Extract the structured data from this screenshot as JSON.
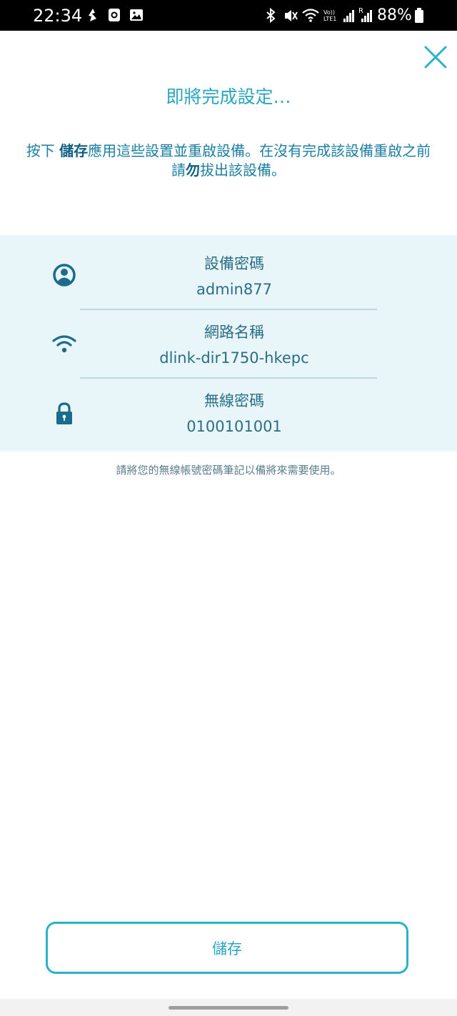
{
  "status_bar": {
    "time": "22:34",
    "battery": "88%",
    "icons": [
      "notification-icon",
      "clock-app-icon",
      "gallery-icon",
      "bluetooth-icon",
      "mute-icon",
      "wifi-icon",
      "volte-icon",
      "signal-icon",
      "roaming-signal-icon",
      "battery-icon"
    ],
    "volte_label": "Vo)) LTE1",
    "roaming_label": "R"
  },
  "header": {
    "title": "即將完成設定…"
  },
  "instructions": {
    "part1": "按下 ",
    "bold1": "儲存",
    "part2": "應用這些設置並重啟設備。在沒有完成該設備重啟之前請",
    "bold2": "勿",
    "part3": "拔出該設備。"
  },
  "info": {
    "device_password": {
      "label": "設備密碼",
      "value": "admin877",
      "icon": "user-icon"
    },
    "network_name": {
      "label": "網路名稱",
      "value": "dlink-dir1750-hkepc",
      "icon": "wifi-icon"
    },
    "wireless_password": {
      "label": "無線密碼",
      "value": "0100101001",
      "icon": "lock-icon"
    }
  },
  "note": "請將您的無線帳號密碼筆記以備將來需要使用。",
  "footer": {
    "save_label": "儲存"
  },
  "colors": {
    "accent": "#2aa6c0",
    "dark_accent": "#1c7fa1",
    "panel_bg": "#e8f6f9",
    "icon": "#1a6b8c"
  }
}
